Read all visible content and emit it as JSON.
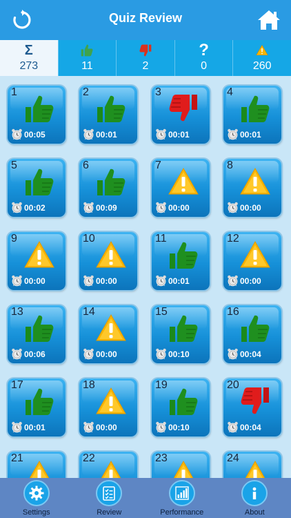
{
  "header": {
    "title": "Quiz Review",
    "back_icon": "refresh-icon",
    "home_icon": "home-icon"
  },
  "stats": [
    {
      "icon": "sigma-icon",
      "value": "273"
    },
    {
      "icon": "thumbs-up-icon",
      "value": "11"
    },
    {
      "icon": "thumbs-down-icon",
      "value": "2"
    },
    {
      "icon": "question-icon",
      "value": "0"
    },
    {
      "icon": "warning-icon",
      "value": "260"
    }
  ],
  "tiles": [
    {
      "num": "1",
      "status": "correct",
      "time": "00:05"
    },
    {
      "num": "2",
      "status": "correct",
      "time": "00:01"
    },
    {
      "num": "3",
      "status": "wrong",
      "time": "00:01"
    },
    {
      "num": "4",
      "status": "correct",
      "time": "00:01"
    },
    {
      "num": "5",
      "status": "correct",
      "time": "00:02"
    },
    {
      "num": "6",
      "status": "correct",
      "time": "00:09"
    },
    {
      "num": "7",
      "status": "skipped",
      "time": "00:00"
    },
    {
      "num": "8",
      "status": "skipped",
      "time": "00:00"
    },
    {
      "num": "9",
      "status": "skipped",
      "time": "00:00"
    },
    {
      "num": "10",
      "status": "skipped",
      "time": "00:00"
    },
    {
      "num": "11",
      "status": "correct",
      "time": "00:01"
    },
    {
      "num": "12",
      "status": "skipped",
      "time": "00:00"
    },
    {
      "num": "13",
      "status": "correct",
      "time": "00:06"
    },
    {
      "num": "14",
      "status": "skipped",
      "time": "00:00"
    },
    {
      "num": "15",
      "status": "correct",
      "time": "00:10"
    },
    {
      "num": "16",
      "status": "correct",
      "time": "00:04"
    },
    {
      "num": "17",
      "status": "correct",
      "time": "00:01"
    },
    {
      "num": "18",
      "status": "skipped",
      "time": "00:00"
    },
    {
      "num": "19",
      "status": "correct",
      "time": "00:10"
    },
    {
      "num": "20",
      "status": "wrong",
      "time": "00:04"
    },
    {
      "num": "21",
      "status": "skipped",
      "time": ""
    },
    {
      "num": "22",
      "status": "skipped",
      "time": ""
    },
    {
      "num": "23",
      "status": "skipped",
      "time": ""
    },
    {
      "num": "24",
      "status": "skipped",
      "time": ""
    }
  ],
  "tabbar": [
    {
      "icon": "gear-icon",
      "label": "Settings"
    },
    {
      "icon": "checklist-icon",
      "label": "Review"
    },
    {
      "icon": "bar-chart-icon",
      "label": "Performance"
    },
    {
      "icon": "info-icon",
      "label": "About"
    }
  ],
  "colors": {
    "header": "#2a9be3",
    "tabbar": "#5e86c4",
    "correct": "#1f8f1f",
    "wrong": "#e01c1c",
    "warning": "#f7b500"
  }
}
